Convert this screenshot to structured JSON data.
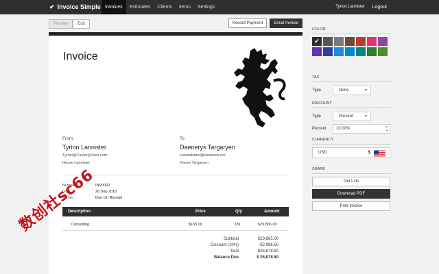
{
  "nav": {
    "brand": "Invoice Simple",
    "links": [
      "Invoices",
      "Estimates",
      "Clients",
      "Items",
      "Settings"
    ],
    "user": "Tyrion Lannister",
    "logout": "Logout"
  },
  "toolbar": {
    "preview": "Preview",
    "edit": "Edit",
    "record_payment": "Record Payment",
    "email_invoice": "Email Invoice"
  },
  "invoice": {
    "title": "Invoice",
    "from_label": "From",
    "from_name": "Tyrion Lannister",
    "from_email": "Tyrion@CasterlyRock.com",
    "from_address": "House Lannister",
    "to_label": "To",
    "to_name": "Daenerys Targaryen",
    "to_email": "sunandstars@westeros.net",
    "to_address": "House Targaryen",
    "number_label": "Number",
    "number": "INV0002",
    "date_label": "Date",
    "date": "28 Sep 2018",
    "terms_label": "Terms",
    "terms": "Due On Receipt",
    "columns": [
      "Description",
      "Price",
      "Qty",
      "Amount"
    ],
    "items": [
      {
        "description": "Consulting",
        "price": "$165.00",
        "qty": "181",
        "amount": "$29,865.00"
      }
    ],
    "subtotal_label": "Subtotal",
    "subtotal": "$29,865.00",
    "discount_label": "Discount (10%)",
    "discount": "-$2,986.50",
    "total_label": "Total",
    "total": "$26,878.50",
    "balance_label": "Balance Due",
    "balance": "$ 26,878.50"
  },
  "watermark": "数创社sc66",
  "sidebar": {
    "color_title": "COLOR",
    "colors": [
      "#2f2f2f",
      "#555555",
      "#7a7a7a",
      "#6b4a3a",
      "#c0392b",
      "#e0336f",
      "#8e44ad",
      "#5e35b1",
      "#303f9f",
      "#1e88e5",
      "#0288d1",
      "#00897b",
      "#2e7d32",
      "#558b2f"
    ],
    "tax_title": "TAX",
    "tax_type_label": "Type",
    "tax_type": "None",
    "discount_title": "DISCOUNT",
    "discount_type_label": "Type",
    "discount_type": "Percent",
    "discount_percent_label": "Percent",
    "discount_percent": "10.00%",
    "currency_title": "CURRENCY",
    "currency": "USD",
    "currency_symbol": "$",
    "share_title": "SHARE",
    "get_link": "Get Link",
    "download_pdf": "Download PDF",
    "print_invoice": "Print Invoice"
  }
}
